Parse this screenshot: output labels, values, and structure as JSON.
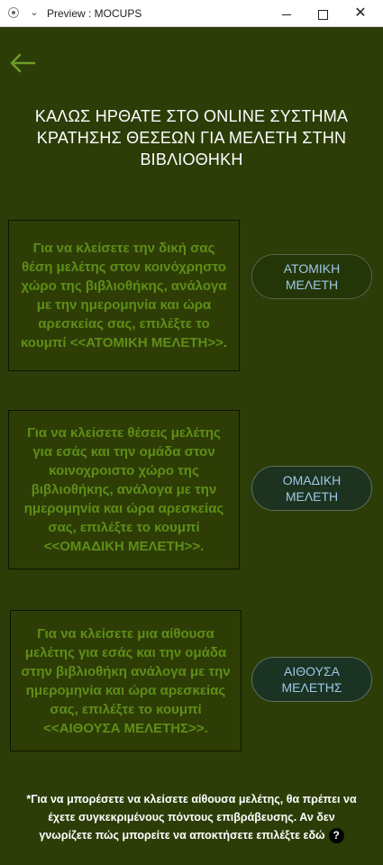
{
  "window": {
    "title": "Preview : MOCUPS"
  },
  "heading": {
    "lines": [
      "ΚΑΛΩΣ ΗΡΘΑΤΕ ΣΤΟ ONLINE ΣΥΣΤΗΜΑ",
      "ΚΡΑΤΗΣΗΣ ΘΕΣΕΩΝ ΓΙΑ ΜΕΛΕΤΗ ΣΤΗΝ",
      "ΒΙΒΛΙΟΘΗΚΗ"
    ]
  },
  "options": [
    {
      "description": [
        "Για να κλείσετε την δική σας",
        "θέση μελέτης στον κοινόχρηστο",
        "χώρο της βιβλιοθήκης, ανάλογα",
        "με την ημερομηνία και ώρα",
        "αρεσκείας σας, επιλέξτε το",
        "κουμπί <<ΑΤΟΜΙΚΗ ΜΕΛΕΤΗ>>."
      ],
      "button": [
        "ΑΤΟΜΙΚΗ",
        "ΜΕΛΕΤΗ"
      ]
    },
    {
      "description": [
        "Για να κλείσετε θέσεις μελέτης",
        "για εσάς και την ομάδα  στον",
        "κοινοχροιστο χώρο της",
        "βιβλιοθήκης, ανάλογα με την",
        "ημερομηνία και ώρα αρεσκείας",
        "σας, επιλέξτε το κουμπί",
        "<<ΟΜΑΔΙΚΗ ΜΕΛΕΤΗ>>."
      ],
      "button": [
        "ΟΜΑΔΙΚΗ",
        "ΜΕΛΕΤΗ"
      ]
    },
    {
      "description": [
        "Για να κλείσετε μια αίθουσα",
        "μελέτης για εσάς και την ομάδα",
        "στην βιβλιοθήκη ανάλογα με την",
        "ημερομηνία και ώρα αρεσκείας",
        "σας, επιλέξτε το κουμπί",
        "<<ΑΙΘΟΥΣΑ ΜΕΛΕΤΗΣ>>."
      ],
      "button": [
        "ΑΙΘΟΥΣΑ",
        "ΜΕΛΕΤΗΣ"
      ]
    }
  ],
  "footnote": {
    "lines": [
      "*Για να μπορέσετε να κλείσετε αίθουσα μελέτης, θα πρέπει να",
      "έχετε συγκεκριμένους πόντους επιβράβευσης. Αν δεν",
      "γνωρίζετε πώς μπορείτε να αποκτήσετε επιλέξτε εδώ"
    ],
    "help_glyph": "?"
  },
  "icons": {
    "back": "arrow-left-icon",
    "help": "question-circle-icon"
  },
  "colors": {
    "background": "#2d3d08",
    "card_text": "#5e8e17",
    "button_text": "#9ec8e6",
    "back_arrow": "#6f9d28"
  }
}
